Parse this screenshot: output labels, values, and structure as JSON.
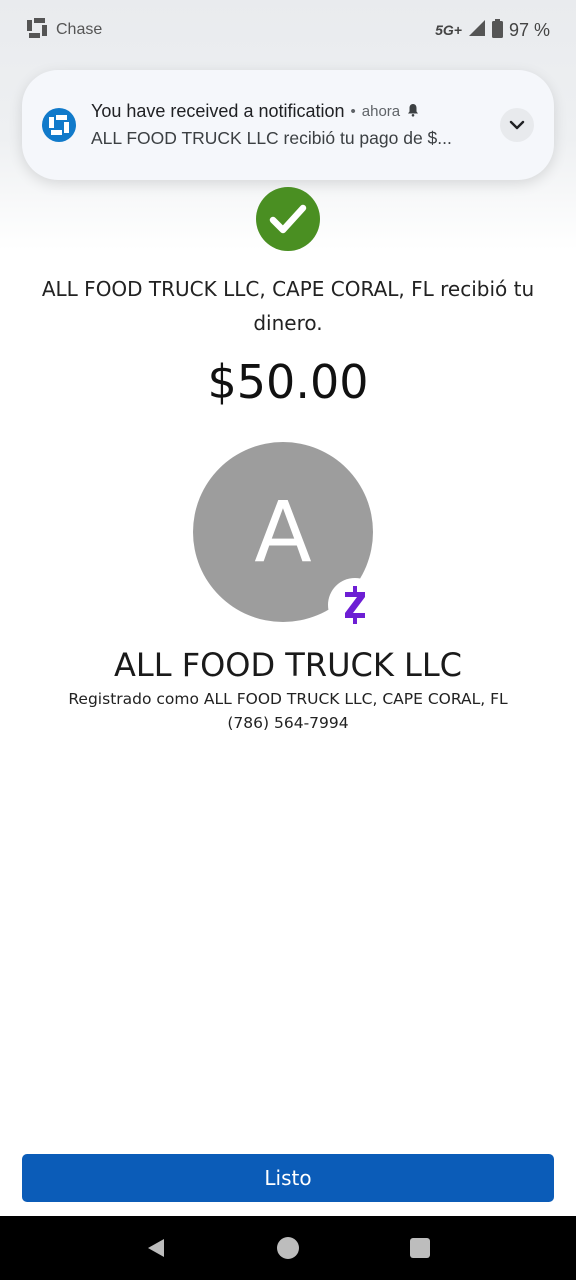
{
  "status_bar": {
    "app_name": "Chase",
    "network": "5G+",
    "battery": "97 %"
  },
  "notification": {
    "title": "You have received a notification",
    "separator": "•",
    "time": "ahora",
    "text": "ALL FOOD TRUCK LLC recibió tu pago de $..."
  },
  "payment": {
    "message": "ALL FOOD TRUCK LLC, CAPE CORAL, FL recibió tu dinero.",
    "amount": "$50.00",
    "avatar_letter": "A",
    "merchant_name": "ALL FOOD TRUCK LLC",
    "registered_as": "Registrado como ALL FOOD TRUCK LLC, CAPE CORAL, FL",
    "phone": "(786) 564-7994"
  },
  "actions": {
    "done_label": "Listo"
  },
  "colors": {
    "success_green": "#4a8f22",
    "button_blue": "#0b5cb8",
    "zelle_purple": "#6d1ed4",
    "chase_blue": "#117aca",
    "avatar_gray": "#9d9d9d"
  },
  "icons": {
    "status_app": "chase-octagon-icon",
    "signal": "signal-icon",
    "battery": "battery-icon",
    "notification_app": "chase-logo-icon",
    "notification_alert": "bell-icon",
    "expand": "chevron-down-icon",
    "success": "checkmark-icon",
    "payment_network": "zelle-icon",
    "nav_back": "back-icon",
    "nav_home": "home-icon",
    "nav_recents": "recents-icon"
  }
}
